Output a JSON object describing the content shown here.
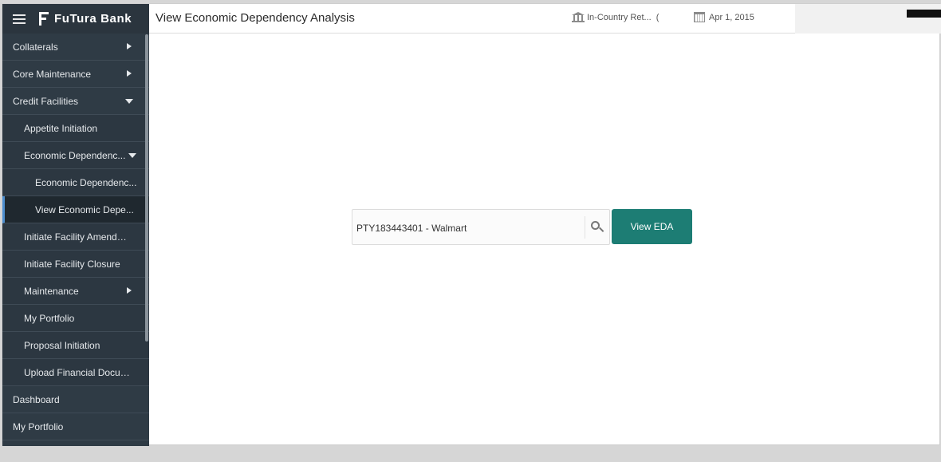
{
  "brand": {
    "name": "FuTura Bank"
  },
  "header": {
    "title": "View Economic Dependency Analysis",
    "entity": "In-Country Ret...",
    "entity_suffix": "(",
    "date": "Apr 1, 2015"
  },
  "sidebar": {
    "items": [
      {
        "label": "Collaterals"
      },
      {
        "label": "Core Maintenance"
      },
      {
        "label": "Credit Facilities"
      },
      {
        "label": "Appetite Initiation"
      },
      {
        "label": "Economic Dependenc..."
      },
      {
        "label": "Economic Dependenc..."
      },
      {
        "label": "View Economic Depe..."
      },
      {
        "label": "Initiate Facility Amendm..."
      },
      {
        "label": "Initiate Facility Closure"
      },
      {
        "label": "Maintenance"
      },
      {
        "label": "My Portfolio"
      },
      {
        "label": "Proposal Initiation"
      },
      {
        "label": "Upload Financial Docum..."
      },
      {
        "label": "Dashboard"
      },
      {
        "label": "My Portfolio"
      }
    ]
  },
  "search": {
    "value": "PTY183443401 - Walmart",
    "button_label": "View EDA"
  },
  "colors": {
    "sidebar_bg": "#2f3b45",
    "accent_teal": "#1d7d74",
    "active_marker": "#4d8ecf"
  }
}
